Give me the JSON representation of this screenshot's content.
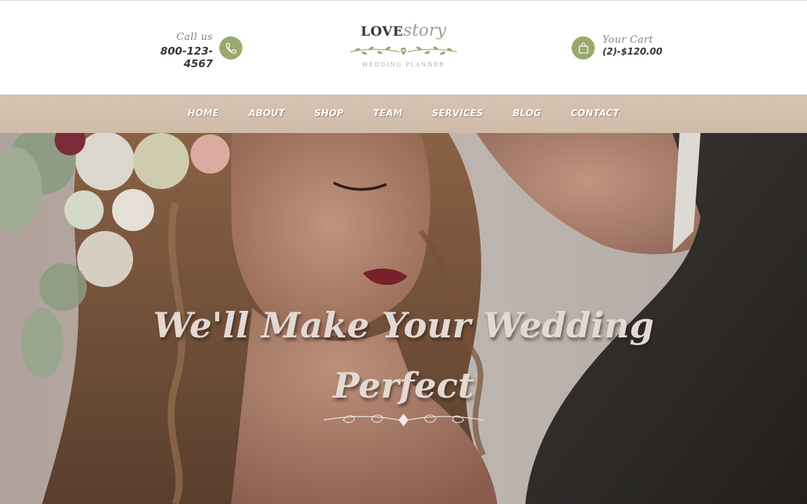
{
  "colors": {
    "accent_green": "#9aa86e",
    "nav_bg": "#d3bfad",
    "text_dark": "#3a3530",
    "text_muted": "#8a8273"
  },
  "header": {
    "call": {
      "label": "Call us",
      "number": "800-123-4567",
      "icon": "phone-icon"
    },
    "logo": {
      "love": "LOVE",
      "story": "story",
      "subtitle": "WEDDING PLANNER",
      "ornament_icon": "floral-ornament-icon"
    },
    "cart": {
      "label": "Your Cart",
      "value": "(2)-$120.00",
      "icon": "shopping-bag-icon"
    }
  },
  "nav": {
    "items": [
      {
        "label": "HOME"
      },
      {
        "label": "ABOUT"
      },
      {
        "label": "SHOP"
      },
      {
        "label": "TEAM"
      },
      {
        "label": "SERVICES"
      },
      {
        "label": "BLOG"
      },
      {
        "label": "CONTACT"
      }
    ]
  },
  "hero": {
    "title_line1": "We'll Make Your Wedding",
    "title_line2": "Perfect",
    "ornament_icon": "floral-divider-icon"
  }
}
